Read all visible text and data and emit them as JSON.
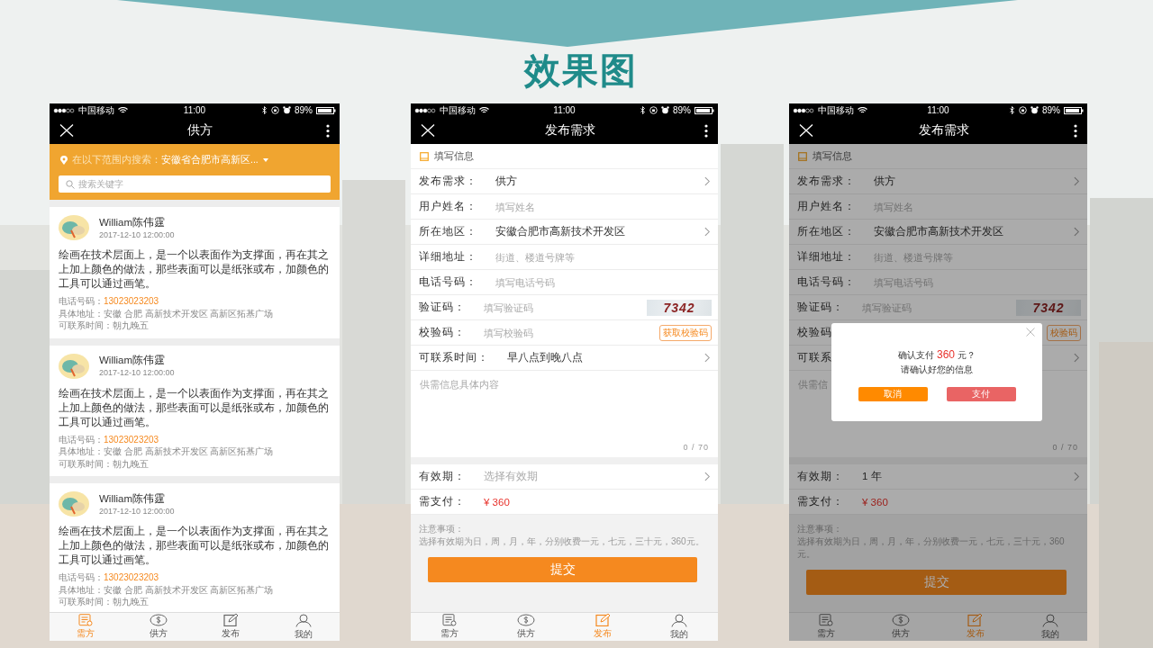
{
  "slide_title": "效果图",
  "screens": [
    {
      "kind": "supply_list",
      "status_bar": {
        "carrier": "中国移动",
        "time": "11:00",
        "battery": "89%"
      },
      "nav_title": "供方",
      "search": {
        "scope_label": "在以下范围内搜索：",
        "scope_value": "安徽省合肥市高新区...",
        "placeholder": "搜索关键字"
      },
      "cards": [
        {
          "name": "William陈伟霆",
          "date": "2017-12-10 12:00:00",
          "body": "绘画在技术层面上，是一个以表面作为支撑面，再在其之上加上颜色的做法，那些表面可以是纸张或布，加颜色的工具可以通过画笔。",
          "phone_label": "电话号码：",
          "phone": "13023023203",
          "address": "具体地址：安徽 合肥 高新技术开发区 高新区拓基广场",
          "hours": "可联系时间：朝九晚五"
        },
        {
          "name": "William陈伟霆",
          "date": "2017-12-10 12:00:00",
          "body": "绘画在技术层面上，是一个以表面作为支撑面，再在其之上加上颜色的做法，那些表面可以是纸张或布，加颜色的工具可以通过画笔。",
          "phone_label": "电话号码：",
          "phone": "13023023203",
          "address": "具体地址：安徽 合肥 高新技术开发区 高新区拓基广场",
          "hours": "可联系时间：朝九晚五"
        },
        {
          "name": "William陈伟霆",
          "date": "2017-12-10 12:00:00",
          "body": "绘画在技术层面上，是一个以表面作为支撑面，再在其之上加上颜色的做法，那些表面可以是纸张或布，加颜色的工具可以通过画笔。",
          "phone_label": "电话号码：",
          "phone": "13023023203",
          "address": "具体地址：安徽 合肥 高新技术开发区 高新区拓基广场",
          "hours": "可联系时间：朝九晚五"
        }
      ],
      "tab_bar": [
        {
          "label": "需方",
          "selected": true
        },
        {
          "label": "供方",
          "selected": false
        },
        {
          "label": "发布",
          "selected": false
        },
        {
          "label": "我的",
          "selected": false
        }
      ]
    },
    {
      "kind": "form",
      "status_bar": {
        "carrier": "中国移动",
        "time": "11:00",
        "battery": "89%"
      },
      "nav_title": "发布需求",
      "section_title": "填写信息",
      "rows": [
        {
          "kind": "select",
          "label": "发布需求：",
          "value": "供方"
        },
        {
          "kind": "input",
          "label": "用户姓名：",
          "placeholder": "填写姓名"
        },
        {
          "kind": "select",
          "label": "所在地区：",
          "value": "安徽合肥市高新技术开发区"
        },
        {
          "kind": "input",
          "label": "详细地址：",
          "placeholder": "街道、楼道号牌等"
        },
        {
          "kind": "input",
          "label": "电话号码：",
          "placeholder": "填写电话号码"
        },
        {
          "kind": "captcha",
          "label": "验证码：",
          "placeholder": "填写验证码",
          "captcha": "7342"
        },
        {
          "kind": "code",
          "label": "校验码：",
          "placeholder": "填写校验码",
          "button": "获取校验码"
        },
        {
          "kind": "select",
          "label": "可联系时间：",
          "value": "早八点到晚八点"
        }
      ],
      "details": {
        "placeholder": "供需信息具体内容",
        "counter": "0 / 70"
      },
      "validity_rows": [
        {
          "kind": "select",
          "label": "有效期：",
          "placeholder": "选择有效期"
        },
        {
          "kind": "price",
          "label": "需支付：",
          "value": "¥ 360"
        }
      ],
      "notice": {
        "title": "注意事项：",
        "text": "选择有效期为日，周，月，年，分别收费一元，七元，三十元，360元。"
      },
      "submit": "提交",
      "tab_bar": [
        {
          "label": "需方",
          "selected": false
        },
        {
          "label": "供方",
          "selected": false
        },
        {
          "label": "发布",
          "selected": true
        },
        {
          "label": "我的",
          "selected": false
        }
      ]
    },
    {
      "kind": "form",
      "status_bar": {
        "carrier": "中国移动",
        "time": "11:00",
        "battery": "89%"
      },
      "nav_title": "发布需求",
      "section_title": "填写信息",
      "rows": [
        {
          "kind": "select",
          "label": "发布需求：",
          "value": "供方"
        },
        {
          "kind": "input",
          "label": "用户姓名：",
          "placeholder": "填写姓名"
        },
        {
          "kind": "select",
          "label": "所在地区：",
          "value": "安徽合肥市高新技术开发区"
        },
        {
          "kind": "input",
          "label": "详细地址：",
          "placeholder": "街道、楼道号牌等"
        },
        {
          "kind": "input",
          "label": "电话号码：",
          "placeholder": "填写电话号码"
        },
        {
          "kind": "captcha",
          "label": "验证码：",
          "placeholder": "填写验证码",
          "captcha": "7342"
        },
        {
          "kind": "code",
          "label": "校验码",
          "button": "校验码"
        },
        {
          "kind": "select",
          "label": "可联系"
        }
      ],
      "details": {
        "placeholder": "供需信",
        "counter": "0 / 70"
      },
      "validity_rows": [
        {
          "kind": "select",
          "label": "有效期：",
          "value": "1 年"
        },
        {
          "kind": "price",
          "label": "需支付：",
          "value": "¥ 360"
        }
      ],
      "notice": {
        "title": "注意事项：",
        "text": "选择有效期为日，周，月，年，分别收费一元，七元，三十元，360元。"
      },
      "submit": "提交",
      "tab_bar": [
        {
          "label": "需方",
          "selected": false
        },
        {
          "label": "供方",
          "selected": false
        },
        {
          "label": "发布",
          "selected": true
        },
        {
          "label": "我的",
          "selected": false
        }
      ],
      "dialog": {
        "message": "确认支付",
        "amount": "360",
        "unit": "元？",
        "hint": "请确认好您的信息",
        "cancel": "取消",
        "confirm": "支付"
      }
    }
  ]
}
